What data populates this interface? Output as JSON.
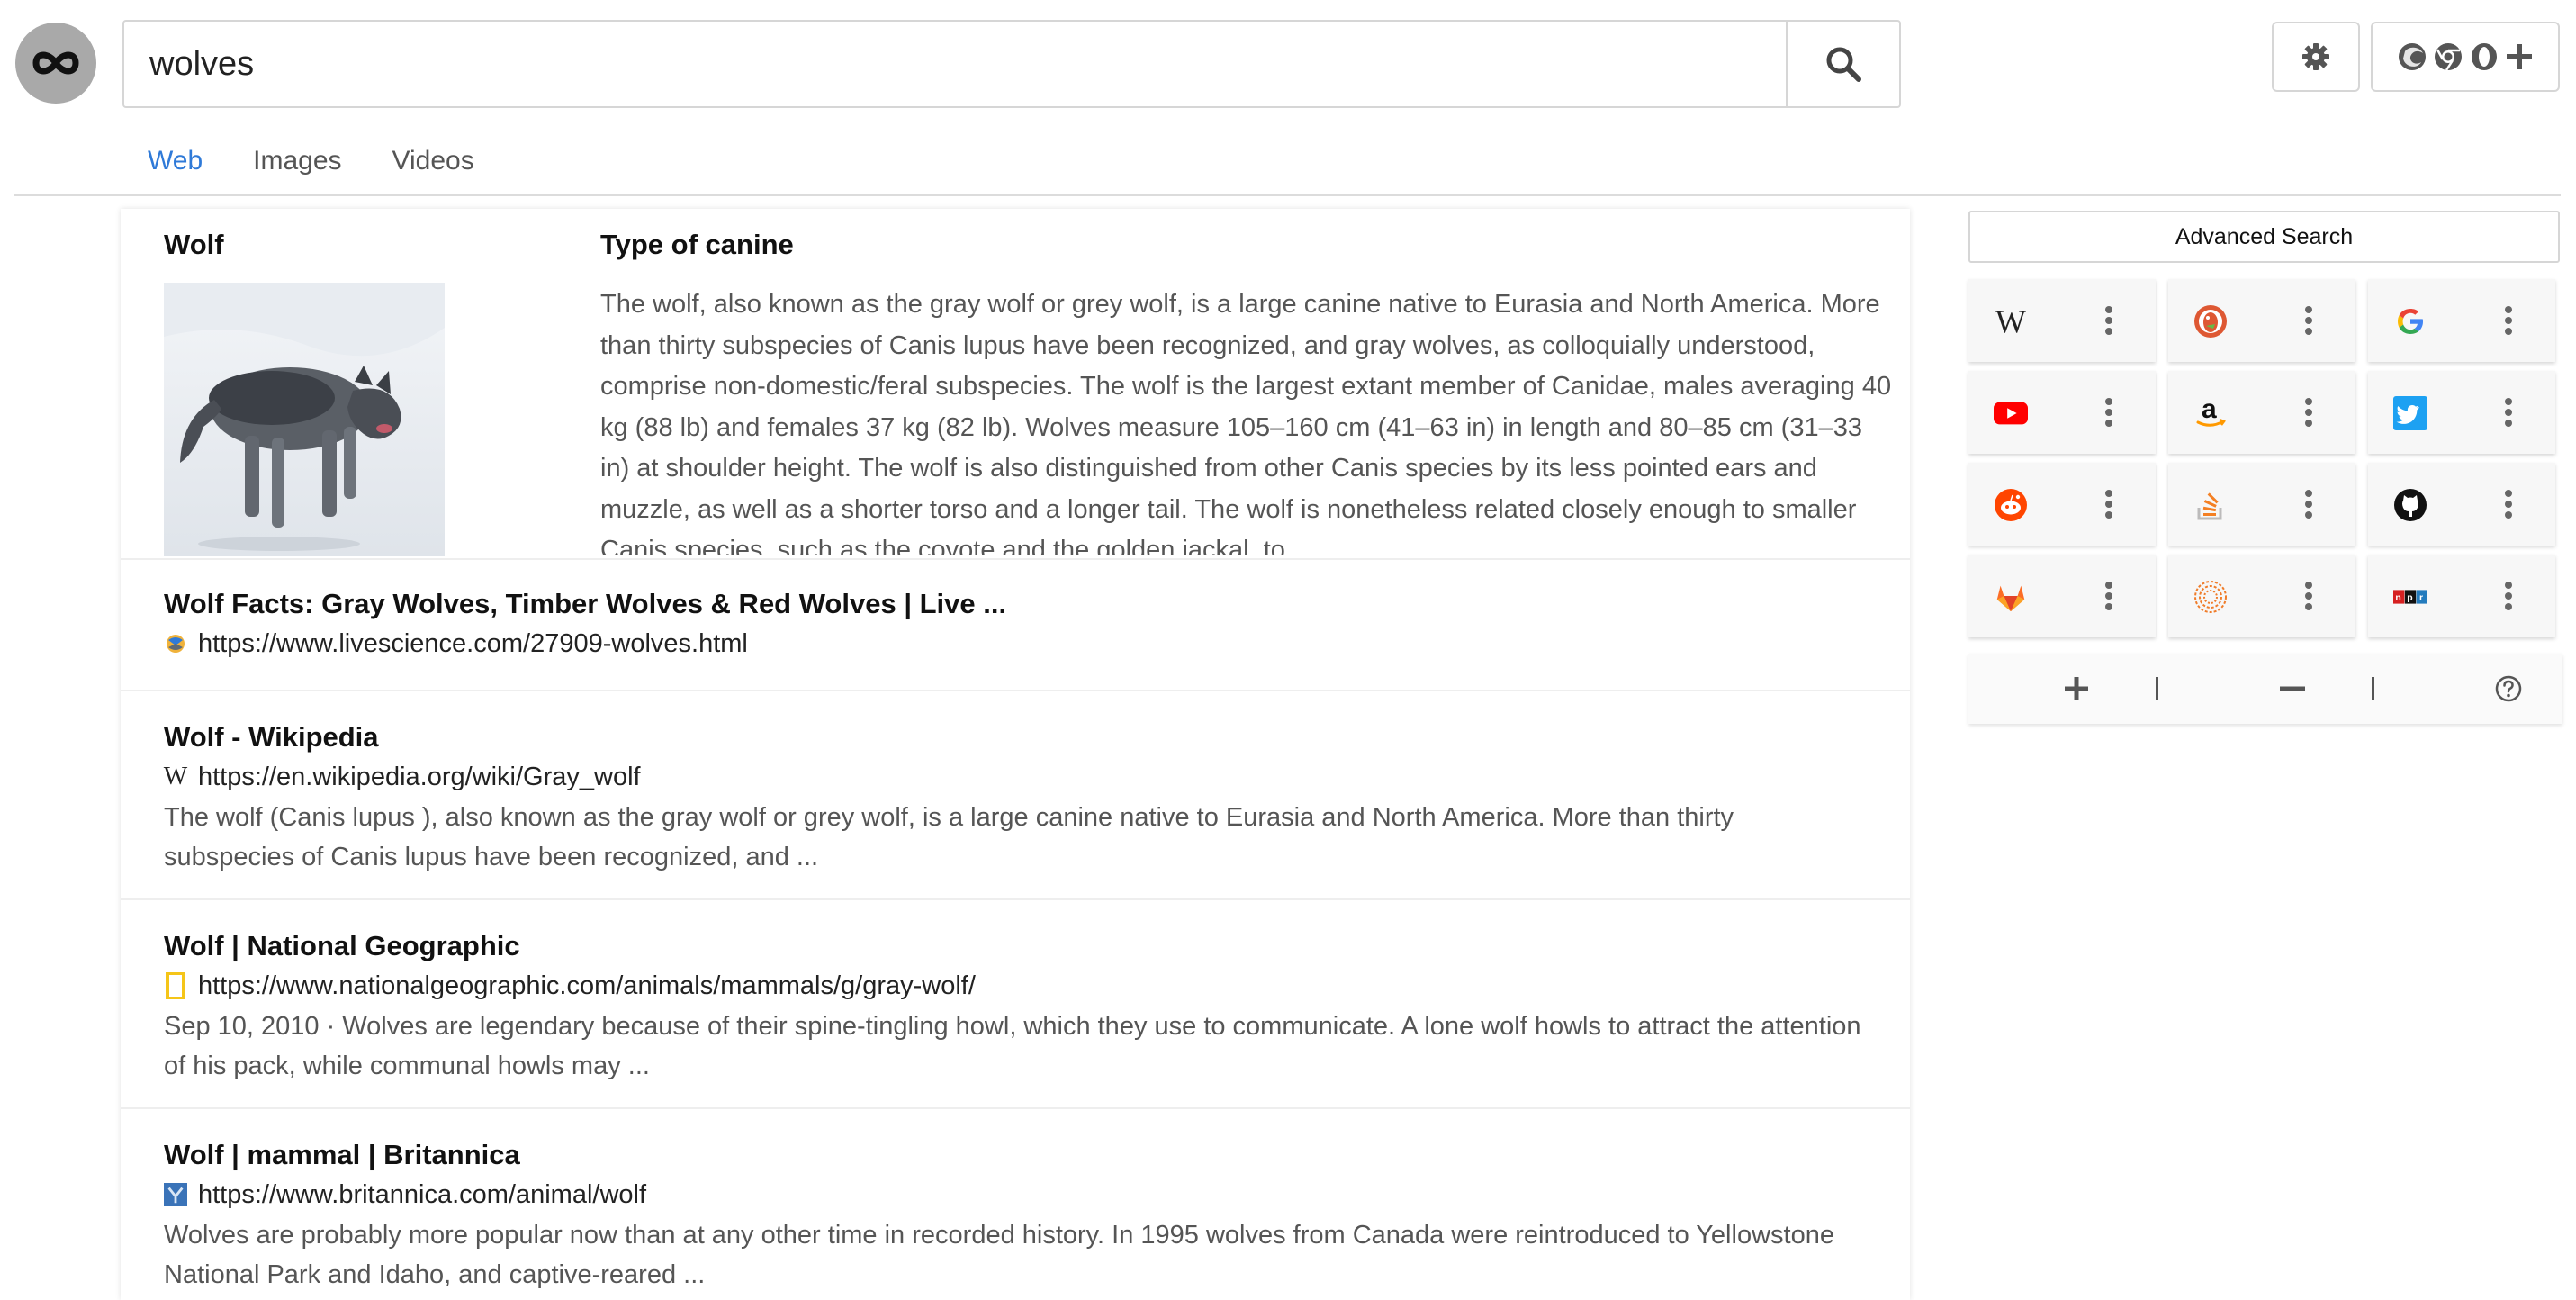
{
  "header": {
    "logo_icon": "infinity-logo-icon",
    "search": {
      "value": "wolves",
      "placeholder": ""
    },
    "search_icon": "magnifier-icon",
    "settings_icon": "gear-icon",
    "browser_icons": [
      "firefox-icon",
      "chrome-icon",
      "opera-icon",
      "plus-icon"
    ]
  },
  "tabs": [
    {
      "label": "Web",
      "active": true
    },
    {
      "label": "Images",
      "active": false
    },
    {
      "label": "Videos",
      "active": false
    }
  ],
  "knowledge_panel": {
    "title": "Wolf",
    "subtitle": "Type of canine",
    "image_icon": "wolf-photo",
    "description": "The wolf, also known as the gray wolf or grey wolf, is a large canine native to Eurasia and North America. More than thirty subspecies of Canis lupus have been recognized, and gray wolves, as colloquially understood, comprise non-domestic/feral subspecies. The wolf is the largest extant member of Canidae, males averaging 40 kg (88 lb) and females 37 kg (82 lb). Wolves measure 105–160 cm (41–63 in) in length and 80–85 cm (31–33 in) at shoulder height. The wolf is also distinguished from other Canis species by its less pointed ears and muzzle, as well as a shorter torso and a longer tail. The wolf is nonetheless related closely enough to smaller Canis species, such as the coyote and the golden jackal, to"
  },
  "results": [
    {
      "title": "Wolf Facts: Gray Wolves, Timber Wolves & Red Wolves | Live ...",
      "url": "https://www.livescience.com/27909-wolves.html",
      "favicon": "livescience-icon",
      "snippet": ""
    },
    {
      "title": "Wolf - Wikipedia",
      "url": "https://en.wikipedia.org/wiki/Gray_wolf",
      "favicon": "wikipedia-icon",
      "snippet": "The wolf (Canis lupus ), also known as the gray wolf or grey wolf, is a large canine native to Eurasia and North America. More than thirty subspecies of Canis lupus have been recognized, and ..."
    },
    {
      "title": "Wolf | National Geographic",
      "url": "https://www.nationalgeographic.com/animals/mammals/g/gray-wolf/",
      "favicon": "natgeo-icon",
      "snippet": "Sep 10, 2010 · Wolves are legendary because of their spine-tingling howl, which they use to communicate. A lone wolf howls to attract the attention of his pack, while communal howls may ..."
    },
    {
      "title": "Wolf | mammal | Britannica",
      "url": "https://www.britannica.com/animal/wolf",
      "favicon": "britannica-icon",
      "snippet": "Wolves are probably more popular now than at any other time in recorded history. In 1995 wolves from Canada were reintroduced to Yellowstone National Park and Idaho, and captive-reared ..."
    }
  ],
  "sidebar": {
    "advanced_search_label": "Advanced Search",
    "shortcuts": [
      {
        "icon": "wikipedia-icon",
        "glyph": "W",
        "color": "#222222"
      },
      {
        "icon": "duckduckgo-icon",
        "glyph": "",
        "color": "#de5833"
      },
      {
        "icon": "google-icon",
        "glyph": "G",
        "color": "#4285f4"
      },
      {
        "icon": "youtube-icon",
        "glyph": "",
        "color": "#ff0000"
      },
      {
        "icon": "amazon-icon",
        "glyph": "a",
        "color": "#111111"
      },
      {
        "icon": "twitter-icon",
        "glyph": "",
        "color": "#1da1f2"
      },
      {
        "icon": "reddit-icon",
        "glyph": "",
        "color": "#ff4500"
      },
      {
        "icon": "stackoverflow-icon",
        "glyph": "",
        "color": "#f48024"
      },
      {
        "icon": "github-icon",
        "glyph": "",
        "color": "#111111"
      },
      {
        "icon": "gitlab-icon",
        "glyph": "",
        "color": "#fc6d26"
      },
      {
        "icon": "sourcegraph-icon",
        "glyph": "",
        "color": "#f07c2a"
      },
      {
        "icon": "npr-icon",
        "glyph": "npr",
        "color": "#d62021"
      }
    ],
    "controls": {
      "add_icon": "plus-icon",
      "separator": "|",
      "remove_icon": "minus-icon",
      "help_icon": "question-icon"
    }
  }
}
